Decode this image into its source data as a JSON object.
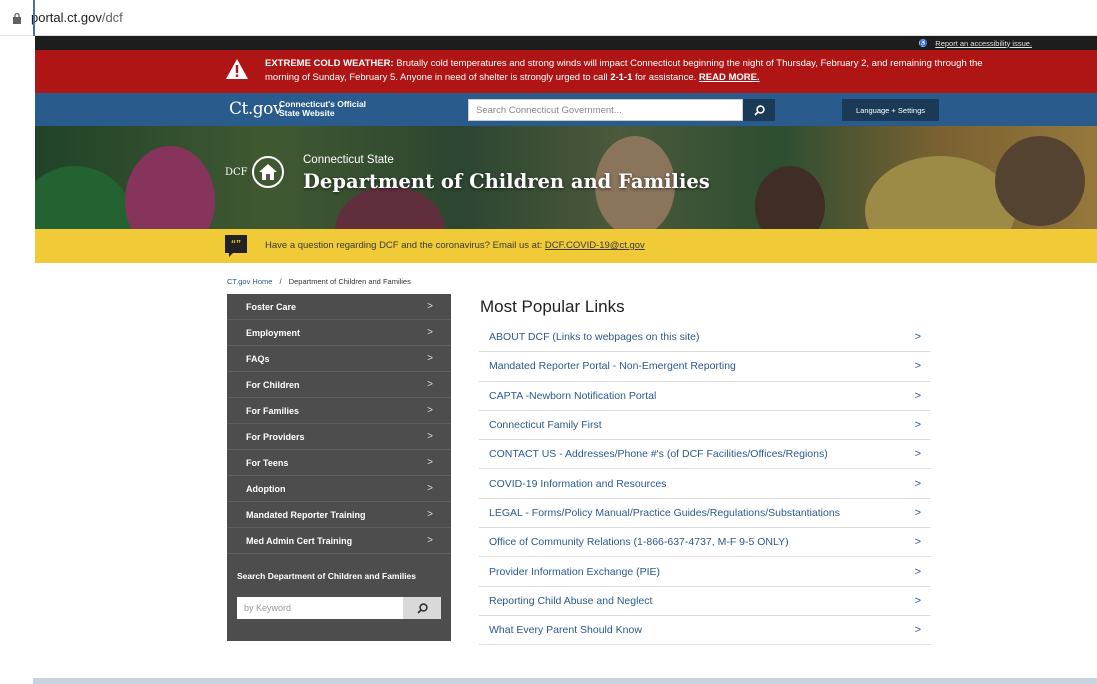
{
  "browser": {
    "url_host": "portal.ct.gov",
    "url_path": "/dcf"
  },
  "accessibility": {
    "link": "Report an accessibility issue."
  },
  "alert": {
    "heading": "EXTREME COLD WEATHER:",
    "text1": " Brutally cold temperatures and strong winds will impact Connecticut beginning the night of Thursday, February 2, and remaining through the morning of Sunday, February 5. Anyone in need of shelter is strongly urged to call ",
    "phone": "2-1-1",
    "text2": " for assistance. ",
    "read_more": "READ MORE."
  },
  "ctbar": {
    "logo": "Ct.gov",
    "logo_sub": "Connecticut's Official State Website",
    "search_placeholder": "Search Connecticut Government...",
    "language_button": "Language + Settings"
  },
  "hero": {
    "logo_text": "DCF",
    "subtitle": "Connecticut State",
    "title": "Department of Children and Families"
  },
  "covid": {
    "text": "Have a question regarding DCF and the coronavirus? Email us at: ",
    "email": "DCF.COVID-19@ct.gov"
  },
  "breadcrumb": {
    "home": "CT.gov Home",
    "sep": "/",
    "current": "Department of Children and Families"
  },
  "sidebar": {
    "items": [
      {
        "label": "Foster Care"
      },
      {
        "label": "Employment"
      },
      {
        "label": "FAQs"
      },
      {
        "label": "For Children"
      },
      {
        "label": "For Families"
      },
      {
        "label": "For Providers"
      },
      {
        "label": "For Teens"
      },
      {
        "label": "Adoption"
      },
      {
        "label": "Mandated Reporter Training"
      },
      {
        "label": "Med Admin Cert Training"
      }
    ],
    "search_label": "Search Department of Children and Families",
    "search_placeholder": "by Keyword"
  },
  "popular": {
    "heading": "Most Popular Links",
    "links": [
      {
        "label": "ABOUT DCF (Links to webpages on this site)"
      },
      {
        "label": "Mandated Reporter Portal - Non-Emergent Reporting"
      },
      {
        "label": "CAPTA -Newborn Notification Portal"
      },
      {
        "label": "Connecticut Family First"
      },
      {
        "label": "CONTACT US - Addresses/Phone #'s (of DCF Facilities/Offices/Regions)"
      },
      {
        "label": "COVID-19 Information and Resources"
      },
      {
        "label": "LEGAL - Forms/Policy Manual/Practice Guides/Regulations/Substantiations"
      },
      {
        "label": "Office of Community Relations (1-866-637-4737, M-F 9-5 ONLY)"
      },
      {
        "label": "Provider Information Exchange (PIE)"
      },
      {
        "label": "Reporting Child Abuse and Neglect"
      },
      {
        "label": "What Every Parent Should Know"
      }
    ]
  },
  "colors": {
    "alert": "#b01515",
    "ctbar": "#2a5b8d",
    "covid": "#f1cb37",
    "sidebar": "#4d4d4d",
    "link": "#2a5b8d"
  }
}
